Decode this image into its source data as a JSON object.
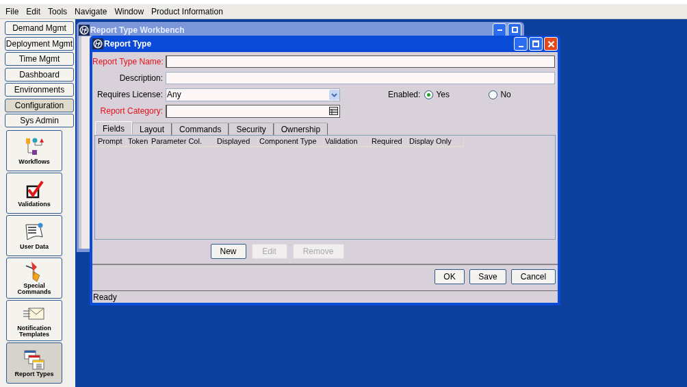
{
  "menu": [
    "File",
    "Edit",
    "Tools",
    "Navigate",
    "Window",
    "Product Information"
  ],
  "sidebar": {
    "nav_buttons": [
      {
        "label": "Demand Mgmt",
        "selected": false
      },
      {
        "label": "Deployment Mgmt",
        "selected": false
      },
      {
        "label": "Time Mgmt",
        "selected": false
      },
      {
        "label": "Dashboard",
        "selected": false
      },
      {
        "label": "Environments",
        "selected": false
      },
      {
        "label": "Configuration",
        "selected": true
      },
      {
        "label": "Sys Admin",
        "selected": false
      }
    ],
    "tools": [
      {
        "label": "Workflows",
        "selected": false
      },
      {
        "label": "Validations",
        "selected": false
      },
      {
        "label": "User Data",
        "selected": false
      },
      {
        "label": "Special Commands",
        "selected": false
      },
      {
        "label": "Notification Templates",
        "selected": false
      },
      {
        "label": "Report Types",
        "selected": true
      }
    ]
  },
  "workbench": {
    "title": "Report Type Workbench"
  },
  "dialog": {
    "title": "Report Type",
    "fields": [
      {
        "label": "Report Type Name:",
        "kind": "text",
        "required": true
      },
      {
        "label": "Description:",
        "kind": "text",
        "required": false
      },
      {
        "label": "Requires License:",
        "kind": "select",
        "required": false,
        "value": "Any"
      },
      {
        "label": "Report Category:",
        "kind": "lookup",
        "required": true
      }
    ],
    "enabled": {
      "label": "Enabled:",
      "options": [
        {
          "label": "Yes",
          "selected": true
        },
        {
          "label": "No",
          "selected": false
        }
      ]
    },
    "tabs": [
      {
        "label": "Fields",
        "selected": true
      },
      {
        "label": "Layout",
        "selected": false
      },
      {
        "label": "Commands",
        "selected": false
      },
      {
        "label": "Security",
        "selected": false
      },
      {
        "label": "Ownership",
        "selected": false
      }
    ],
    "table": {
      "columns": [
        "Prompt",
        "Token",
        "Parameter Col.",
        "Displayed",
        "Component Type",
        "Validation",
        "Required",
        "Display Only"
      ]
    },
    "table_buttons": [
      {
        "label": "New",
        "disabled": false
      },
      {
        "label": "Edit",
        "disabled": true
      },
      {
        "label": "Remove",
        "disabled": true
      }
    ],
    "buttons": [
      "OK",
      "Save",
      "Cancel"
    ],
    "status_bar": "Ready"
  }
}
